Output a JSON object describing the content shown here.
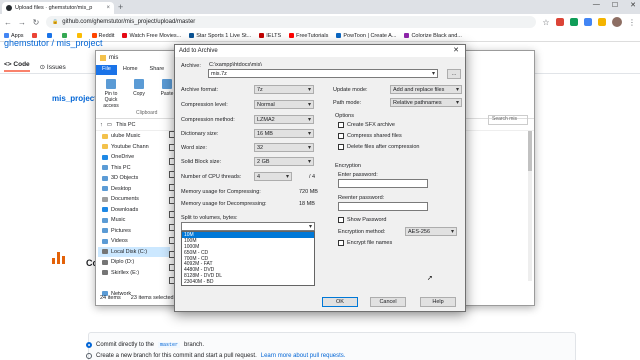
{
  "browser": {
    "tab_title": "Upload files · ghemstutor/mis_p",
    "tab_close": "×",
    "new_tab": "+",
    "window_controls": [
      "—",
      "☐",
      "✕"
    ],
    "url": "github.com/ghemstutor/mis_project/upload/master",
    "bookmarks": [
      {
        "label": "Apps",
        "color": "#4285f4"
      },
      {
        "label": "",
        "color": "#ea4335"
      },
      {
        "label": "",
        "color": "#1a73e8"
      },
      {
        "label": "",
        "color": "#34a853"
      },
      {
        "label": "",
        "color": "#fbbc04"
      },
      {
        "label": "Reddit",
        "color": "#ff4500"
      },
      {
        "label": "Watch Free Movies...",
        "color": "#e50914"
      },
      {
        "label": "Star Sports 1 Live St...",
        "color": "#0b5394"
      },
      {
        "label": "IELTS",
        "color": "#c00000"
      },
      {
        "label": "FreeTutorials",
        "color": "#ff0000"
      },
      {
        "label": "PowToon | Create A...",
        "color": "#0a66c2"
      },
      {
        "label": "Colorize Black and...",
        "color": "#8e24aa"
      }
    ]
  },
  "github": {
    "repo_title": "ghemstutor / mis_project",
    "tab_code": "Code",
    "tab_issues": "Issues",
    "path": "mis_project /",
    "commit_label": "Co",
    "commit_direct_1": "Commit directly to the",
    "commit_direct_branch": "master",
    "commit_direct_2": "branch.",
    "commit_new_1": "Create a new branch for this commit and start a pull request.",
    "commit_new_link": "Learn more about pull requests."
  },
  "explorer": {
    "title": "mis",
    "ribbon_tabs": [
      "File",
      "Home",
      "Share"
    ],
    "ribbon_buttons": [
      "Pin to Quick access",
      "Copy",
      "Paste"
    ],
    "ribbon_group": "Clipboard",
    "address": "This PC",
    "search_placeholder": "Search mis",
    "nav_items": [
      {
        "label": "ulube Music",
        "color": "#f3c14b"
      },
      {
        "label": "Youtube Chann",
        "color": "#f3c14b"
      },
      {
        "label": "OneDrive",
        "color": "#1e88e5"
      },
      {
        "label": "This PC",
        "color": "#5b9bd5"
      },
      {
        "label": "3D Objects",
        "color": "#5b9bd5"
      },
      {
        "label": "Desktop",
        "color": "#5b9bd5"
      },
      {
        "label": "Documents",
        "color": "#9e9e9e"
      },
      {
        "label": "Downloads",
        "color": "#1e88e5"
      },
      {
        "label": "Music",
        "color": "#5b9bd5"
      },
      {
        "label": "Pictures",
        "color": "#5b9bd5"
      },
      {
        "label": "Videos",
        "color": "#5b9bd5"
      },
      {
        "label": "Local Disk (C:)",
        "color": "#757575"
      },
      {
        "label": "Diplo (D:)",
        "color": "#757575"
      },
      {
        "label": "Skirllex (E:)",
        "color": "#757575"
      },
      {
        "label": "",
        "color": "transparent"
      },
      {
        "label": "Network",
        "color": "#5b9bd5"
      }
    ],
    "status_items": "24 items",
    "status_selected": "23 items selected"
  },
  "dialog": {
    "title": "Add to Archive",
    "archive_label": "Archive:",
    "archive_path": "C:\\xampp\\htdocs\\mis\\",
    "archive_name": "mis.7z",
    "browse": "...",
    "format_label": "Archive format:",
    "format_value": "7z",
    "level_label": "Compression level:",
    "level_value": "Normal",
    "method_label": "Compression method:",
    "method_value": "LZMA2",
    "dict_label": "Dictionary size:",
    "dict_value": "16 MB",
    "word_label": "Word size:",
    "word_value": "32",
    "solid_label": "Solid Block size:",
    "solid_value": "2 GB",
    "threads_label": "Number of CPU threads:",
    "threads_value": "4",
    "threads_max": "/ 4",
    "mem_comp_label": "Memory usage for Compressing:",
    "mem_comp_value": "720 MB",
    "mem_decomp_label": "Memory usage for Decompressing:",
    "mem_decomp_value": "18 MB",
    "split_label": "Split to volumes, bytes:",
    "split_options": [
      "10M",
      "100M",
      "1000M",
      "650M - CD",
      "700M - CD",
      "4092M - FAT",
      "4480M - DVD",
      "8128M - DVD DL",
      "23040M - BD"
    ],
    "update_label": "Update mode:",
    "update_value": "Add and replace files",
    "pathmode_label": "Path mode:",
    "pathmode_value": "Relative pathnames",
    "options_title": "Options",
    "opt_sfx": "Create SFX archive",
    "opt_shared": "Compress shared files",
    "opt_delete": "Delete files after compression",
    "enc_title": "Encryption",
    "enc_password": "Enter password:",
    "enc_reenter": "Reenter password:",
    "enc_show": "Show Password",
    "enc_method_label": "Encryption method:",
    "enc_method_value": "AES-256",
    "enc_names": "Encrypt file names",
    "ok": "OK",
    "cancel": "Cancel",
    "help": "Help"
  }
}
